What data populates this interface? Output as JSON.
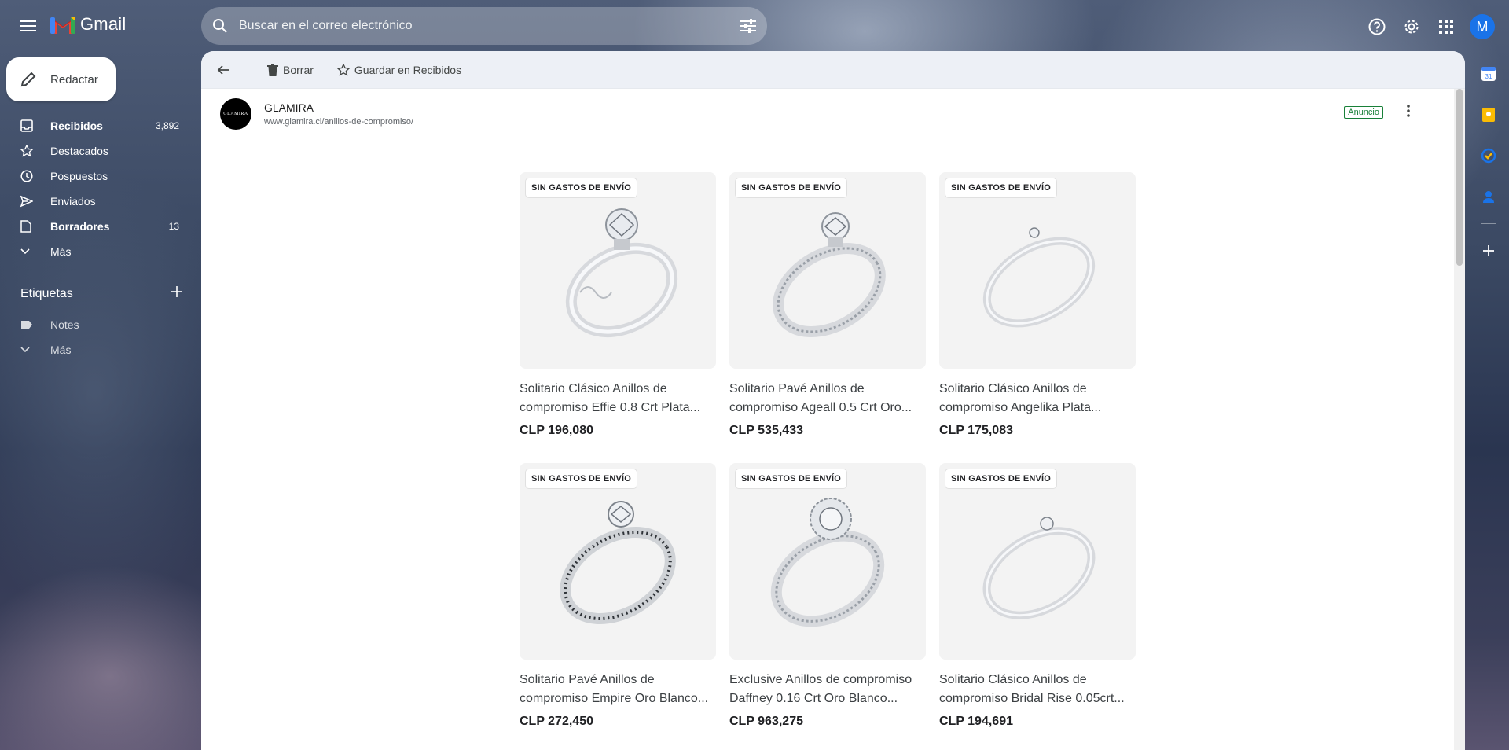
{
  "app": {
    "logo_text": "Gmail"
  },
  "search": {
    "placeholder": "Buscar en el correo electrónico"
  },
  "account": {
    "initial": "M"
  },
  "compose": {
    "label": "Redactar"
  },
  "sidebar": {
    "items": [
      {
        "label": "Recibidos",
        "count": "3,892",
        "icon": "inbox-icon"
      },
      {
        "label": "Destacados",
        "count": "",
        "icon": "star-icon"
      },
      {
        "label": "Pospuestos",
        "count": "",
        "icon": "clock-icon"
      },
      {
        "label": "Enviados",
        "count": "",
        "icon": "send-icon"
      },
      {
        "label": "Borradores",
        "count": "13",
        "icon": "draft-icon"
      },
      {
        "label": "Más",
        "count": "",
        "icon": "chevron-down-icon"
      }
    ],
    "labels_title": "Etiquetas",
    "labels": [
      {
        "label": "Notes",
        "icon": "label-icon"
      },
      {
        "label": "Más",
        "icon": "chevron-down-icon"
      }
    ]
  },
  "toolbar": {
    "delete_label": "Borrar",
    "save_label": "Guardar en Recibidos"
  },
  "message": {
    "sender_name": "GLAMIRA",
    "sender_url": "www.glamira.cl/anillos-de-compromiso/",
    "avatar_text": "GLAMIRA",
    "ad_label": "Anuncio"
  },
  "products": [
    {
      "badge": "SIN GASTOS DE ENVÍO",
      "title": "Solitario Clásico Anillos de compromiso Effie 0.8 Crt Plata...",
      "price": "CLP 196,080",
      "style": "twist"
    },
    {
      "badge": "SIN GASTOS DE ENVÍO",
      "title": "Solitario Pavé Anillos de compromiso Ageall 0.5 Crt Oro...",
      "price": "CLP 535,433",
      "style": "pave"
    },
    {
      "badge": "SIN GASTOS DE ENVÍO",
      "title": "Solitario Clásico Anillos de compromiso Angelika Plata...",
      "price": "CLP 175,083",
      "style": "thin"
    },
    {
      "badge": "SIN GASTOS DE ENVÍO",
      "title": "Solitario Pavé Anillos de compromiso Empire Oro Blanco...",
      "price": "CLP 272,450",
      "style": "pave"
    },
    {
      "badge": "SIN GASTOS DE ENVÍO",
      "title": "Exclusive Anillos de compromiso Daffney 0.16 Crt Oro Blanco...",
      "price": "CLP 963,275",
      "style": "halo"
    },
    {
      "badge": "SIN GASTOS DE ENVÍO",
      "title": "Solitario Clásico Anillos de compromiso Bridal Rise 0.05crt...",
      "price": "CLP 194,691",
      "style": "thin"
    }
  ],
  "colors": {
    "accent": "#1a73e8",
    "ad_green": "#188038",
    "panel_bg": "#ffffff"
  }
}
